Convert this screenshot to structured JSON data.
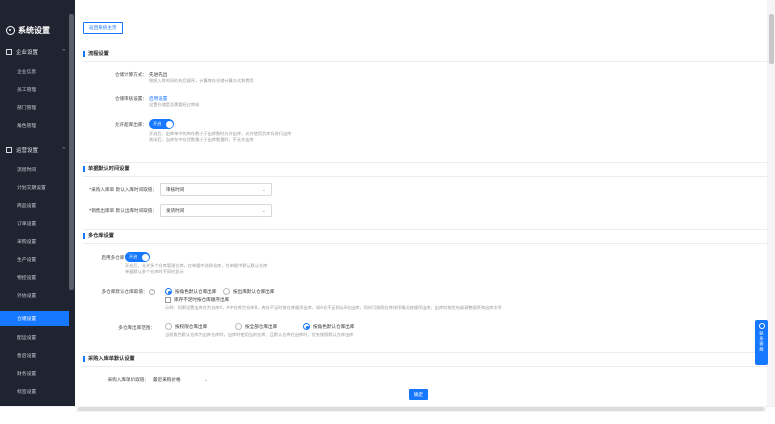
{
  "app": {
    "title": "系统设置"
  },
  "sidebar": {
    "groups": [
      {
        "label": "企业设置",
        "items": [
          "企业信息",
          "员工管理",
          "部门管理",
          "角色管理"
        ]
      },
      {
        "label": "运营设置",
        "items": [
          "流程时间",
          "计划交期设置",
          "商品设置",
          "订单设置",
          "采购设置",
          "生产设置",
          "物控设置",
          "外协设置",
          "仓储设置",
          "配运设置",
          "售后设置",
          "财务设置",
          "标签设置"
        ]
      }
    ],
    "active_item": "仓储设置"
  },
  "main": {
    "top_button": "返回系统主页",
    "sections": {
      "flow": {
        "title": "流程设置",
        "cost_method_label": "仓储计算方式：",
        "cost_method_value": "先进先出",
        "cost_method_desc": "按照入库时间的先后顺序，计算库存仓储计算方式和费用",
        "audit_label": "仓储审核设置：",
        "audit_value": "启用设置",
        "audit_desc": "设置仓储是否需要经过审核",
        "negative_label": "允许超库出库：",
        "negative_toggle": "开启",
        "negative_desc_1": "开启后，出库单中的库存数小于出库数时允许出库，允许使用负库存进行出库",
        "negative_desc_2": "关闭后，当库存中存货数量小于出库数量时，不允许出库"
      },
      "doc_time": {
        "title": "单据默认时间设置",
        "inbound_label": "*采购入库单 默认入库时间取值：",
        "inbound_value": "审核时间",
        "outbound_label": "*销售出库单 默认出库时间取值：",
        "outbound_value": "发货时间"
      },
      "multi_wh": {
        "title": "多仓库设置",
        "enable_label": "启用多仓库：",
        "enable_toggle": "开启",
        "enable_desc_1": "开启后，允许多个仓库管理仓库，在单据中选择仓库，在单据中默认默认仓库",
        "enable_desc_2": "单据默认多个仓库时不同时显示",
        "default_wh_label": "多仓库默认仓库取值：",
        "default_wh_opt1": "按角色默认仓库出库",
        "default_wh_opt2": "按出库默认仓库出库",
        "default_wh_check": "库存不足时按仓库顺序出库",
        "default_wh_desc": "示例：如果设置出库仓为仓库A，A中仓库为仓库B，库存不足时按仓库顺序出库，如A仓不足则从B仓出库，同时可按照仓库排序情况按顺序出库，出库时按优先级调整顺序和出库次序",
        "range_label": "多仓库出库范围：",
        "range_opt1": "按权限仓库出库",
        "range_opt2": "按全部仓库出库",
        "range_opt3": "按角色默认仓库出库",
        "range_desc": "当前角色默认仓库为出库仓库时，出库时使用当前仓库、且默认仓库在出库时，优先按照默认仓库出库"
      },
      "purchase_inbound": {
        "title": "采购入库单默认设置",
        "price_label": "采购入库单价取值：",
        "price_value": "最近采购价格"
      }
    },
    "confirm_button": "确定",
    "float_help": "联系客服"
  }
}
